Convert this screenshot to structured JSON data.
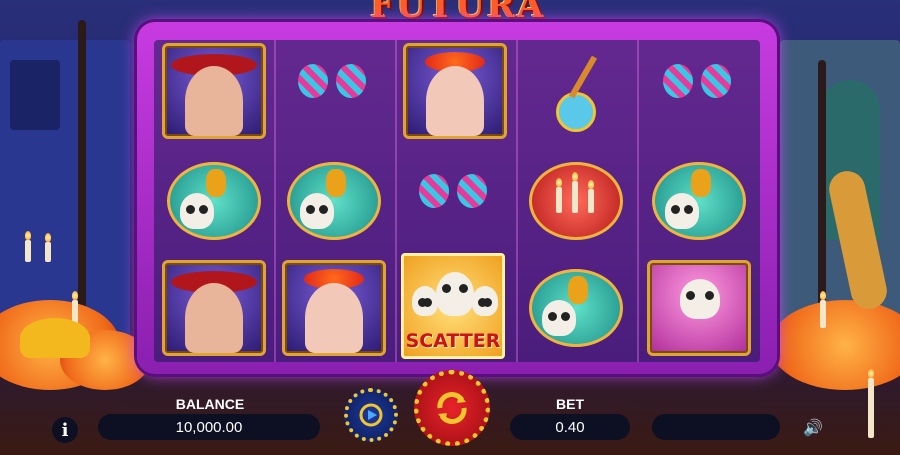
{
  "game": {
    "title": "FUTURA"
  },
  "reels": {
    "columns": 5,
    "rows": 3,
    "symbols": [
      [
        "mariachi-man",
        "calavera-woman-card",
        "mariachi-man"
      ],
      [
        "maracas",
        "skull-pineapple",
        "calavera-woman-card"
      ],
      [
        "calavera-woman",
        "maracas",
        "scatter"
      ],
      [
        "guitar",
        "candles",
        "skull-pineapple"
      ],
      [
        "maracas",
        "skull-pineapple",
        "cat-skull"
      ]
    ],
    "scatter_label": "SCATTER"
  },
  "controls": {
    "balance_label": "BALANCE",
    "balance_value": "10,000.00",
    "bet_label": "BET",
    "bet_value": "0.40",
    "info_label": "i",
    "sound_icon": "🔊"
  },
  "colors": {
    "frame": "#c73be0",
    "spin": "#e8232a",
    "gold": "#f2c52c"
  }
}
